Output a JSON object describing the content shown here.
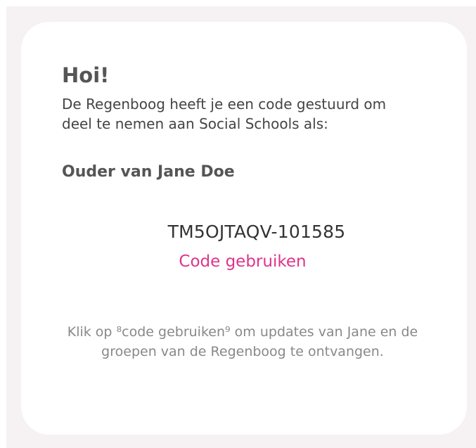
{
  "card": {
    "greeting": "Hoi!",
    "message": "De Regenboog heeft je een code gestuurd om deel te nemen aan Social Schools als:",
    "role": "Ouder van Jane Doe",
    "code": "TM5OJTAQV-101585",
    "use_code_label": "Code gebruiken",
    "info": "Klik op ⁸code gebruiken⁹ om updates van Jane en de groepen van de Regenboog te ontvangen."
  },
  "colors": {
    "accent": "#e0338a",
    "background": "#f6f2f3",
    "card": "#ffffff"
  }
}
